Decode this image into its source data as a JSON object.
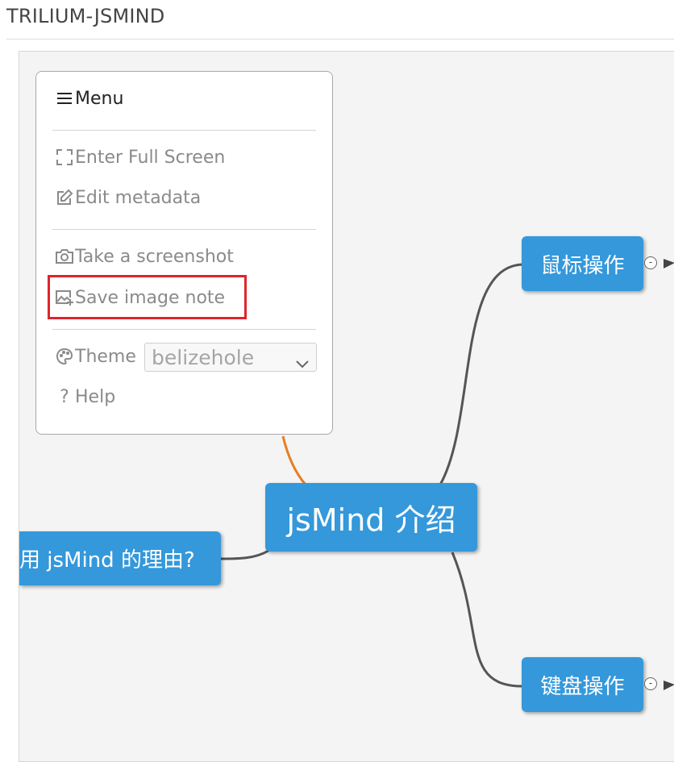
{
  "app": {
    "title": "TRILIUM-JSMIND"
  },
  "menu": {
    "header_label": "Menu",
    "header_icon": "hamburger-icon",
    "items": [
      {
        "label": "Enter Full Screen",
        "icon": "fullscreen-icon"
      },
      {
        "label": "Edit metadata",
        "icon": "edit-icon"
      },
      {
        "label": "Take a screenshot",
        "icon": "camera-icon"
      },
      {
        "label": "Save image note",
        "icon": "image-add-icon"
      }
    ],
    "theme": {
      "label": "Theme",
      "icon": "palette-icon",
      "selected": "belizehole"
    },
    "help": {
      "label": "Help",
      "icon": "help-icon"
    }
  },
  "mindmap": {
    "root": "jsMind 介绍",
    "left_node": "用 jsMind 的理由?",
    "right_top": "鼠标操作",
    "right_bottom": "键盘操作",
    "expander_glyph": "-"
  },
  "colors": {
    "node_bg": "#3498db",
    "link": "#555555",
    "link_highlight": "#e67e22",
    "highlight_box": "#e0242b"
  }
}
